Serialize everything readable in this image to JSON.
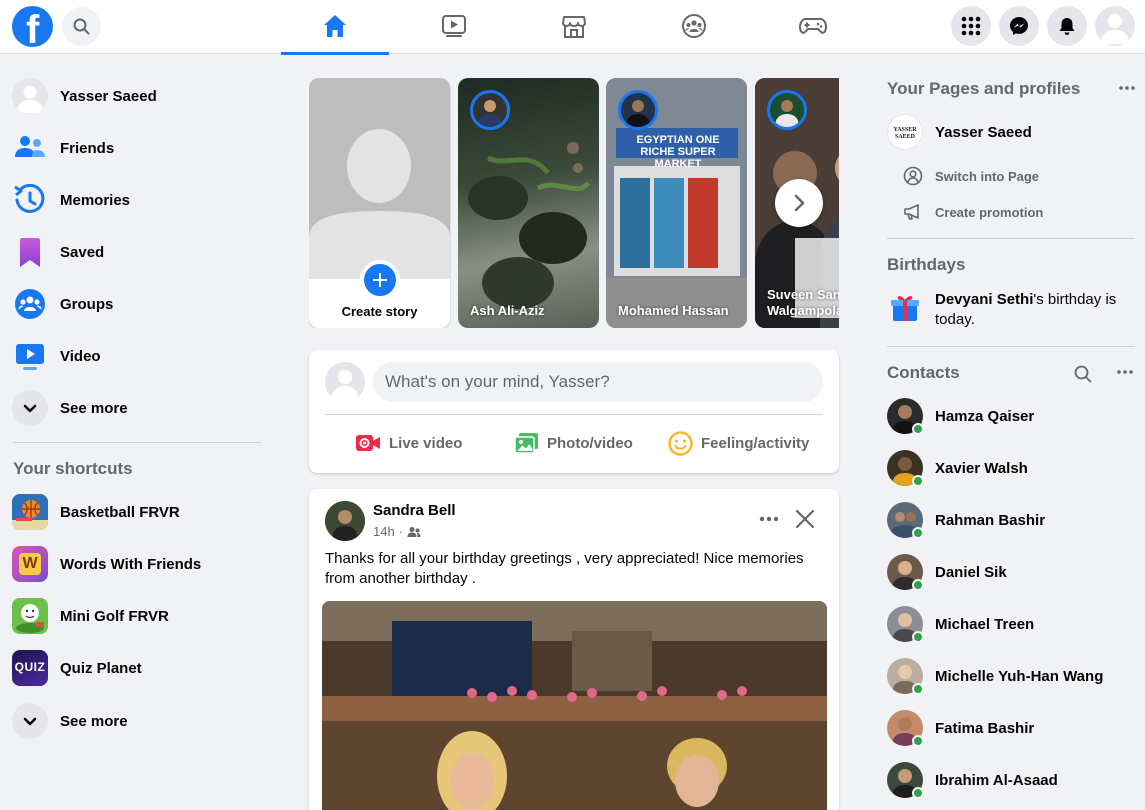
{
  "topbar": {
    "logo_letter": "f",
    "nav_tabs": [
      {
        "name": "home",
        "active": true
      },
      {
        "name": "watch",
        "active": false
      },
      {
        "name": "marketplace",
        "active": false
      },
      {
        "name": "groups",
        "active": false
      },
      {
        "name": "gaming",
        "active": false
      }
    ],
    "right_buttons": [
      "menu-grid-icon",
      "messenger-icon",
      "bell-icon",
      "account-avatar"
    ]
  },
  "sidebar": {
    "items": [
      {
        "label": "Yasser Saeed",
        "icon": "profile-avatar"
      },
      {
        "label": "Friends",
        "icon": "friends-icon"
      },
      {
        "label": "Memories",
        "icon": "memories-clock-icon"
      },
      {
        "label": "Saved",
        "icon": "bookmark-icon"
      },
      {
        "label": "Groups",
        "icon": "groups-icon"
      },
      {
        "label": "Video",
        "icon": "video-icon"
      },
      {
        "label": "See more",
        "icon": "chevron-down-icon"
      }
    ],
    "shortcuts_heading": "Your shortcuts",
    "shortcuts": [
      {
        "label": "Basketball FRVR",
        "icon": "basketball-icon"
      },
      {
        "label": "Words With Friends",
        "icon": "words-icon",
        "glyph": "W"
      },
      {
        "label": "Mini Golf FRVR",
        "icon": "golf-icon"
      },
      {
        "label": "Quiz Planet",
        "icon": "quiz-icon",
        "glyph": "QUIZ"
      },
      {
        "label": "See more",
        "icon": "chevron-down-icon"
      }
    ]
  },
  "stories": {
    "create_label": "Create story",
    "items": [
      {
        "name": "Ash Ali-Aziz"
      },
      {
        "name": "Mohamed Hassan",
        "sign_text": "EGYPTIAN ONE RICHE SUPER MARKET"
      },
      {
        "name": "Suveen Sandith Walgampola",
        "name_line1": "Suveen San",
        "name_line2": "Walgampola"
      }
    ]
  },
  "composer": {
    "placeholder": "What's on your mind, Yasser?",
    "actions": [
      {
        "label": "Live video",
        "color": "#f02849"
      },
      {
        "label": "Photo/video",
        "color": "#45bd62"
      },
      {
        "label": "Feeling/activity",
        "color": "#f7b928"
      }
    ]
  },
  "post": {
    "author": "Sandra Bell",
    "time": "14h",
    "separator": "·",
    "audience_icon": "friends-audience-icon",
    "text": "Thanks for all your birthday greetings , very appreciated! Nice memories from another birthday ."
  },
  "right": {
    "pages_heading": "Your Pages and profiles",
    "page_name": "Yasser Saeed",
    "page_logo_text": "YASSER SAEED",
    "page_actions": [
      {
        "label": "Switch into Page",
        "icon": "switch-profile-icon"
      },
      {
        "label": "Create promotion",
        "icon": "megaphone-icon"
      }
    ],
    "birthdays_heading": "Birthdays",
    "birthday_name": "Devyani Sethi",
    "birthday_rest": "'s birthday is today.",
    "contacts_heading": "Contacts",
    "contacts": [
      {
        "name": "Hamza Qaiser"
      },
      {
        "name": "Xavier Walsh"
      },
      {
        "name": "Rahman Bashir"
      },
      {
        "name": "Daniel Sik"
      },
      {
        "name": "Michael Treen"
      },
      {
        "name": "Michelle Yuh-Han Wang"
      },
      {
        "name": "Fatima Bashir"
      },
      {
        "name": "Ibrahim Al-Asaad"
      }
    ]
  },
  "colors": {
    "brand": "#1877f2",
    "background": "#f0f2f5",
    "secondary_text": "#65676b",
    "online": "#31a24c"
  }
}
